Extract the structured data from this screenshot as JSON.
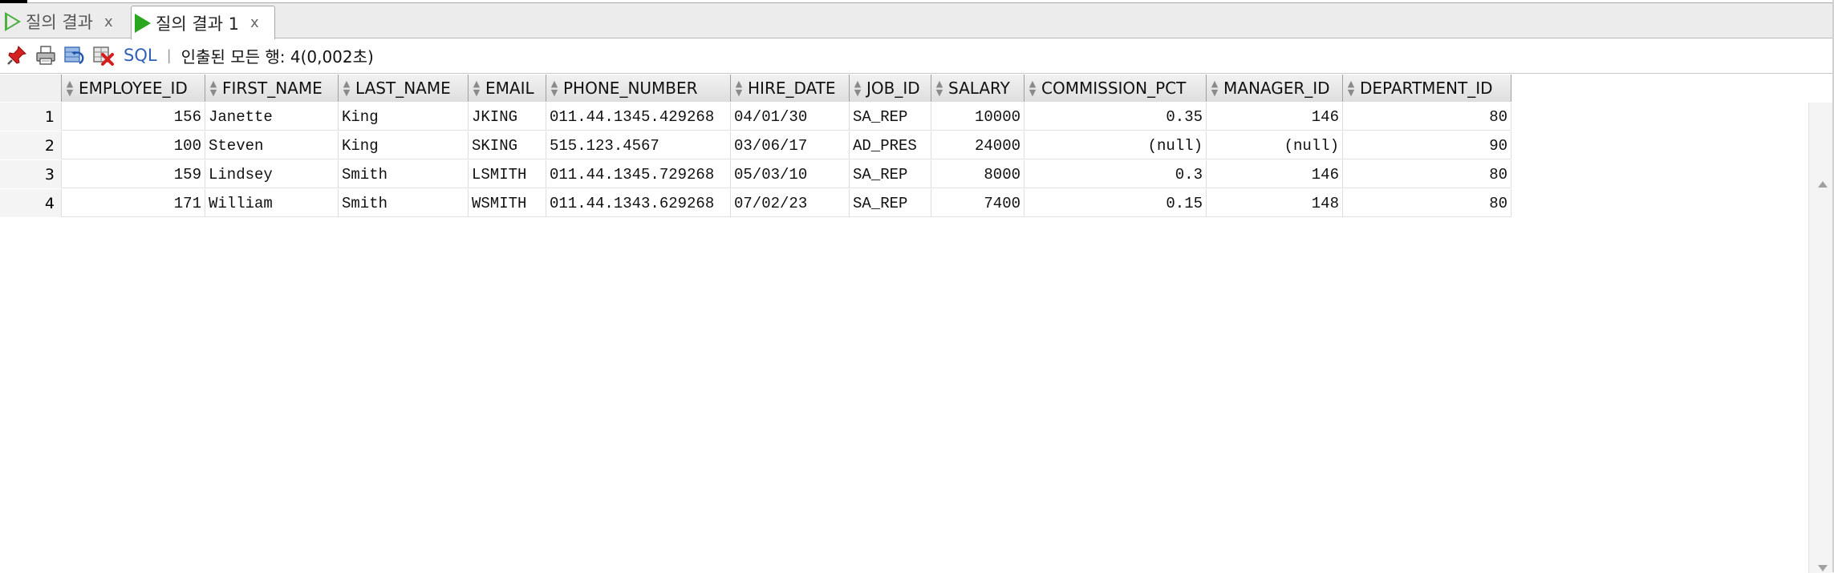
{
  "tabs": [
    {
      "label": "질의 결과",
      "close": "x",
      "active": false
    },
    {
      "label": "질의 결과 1",
      "close": "x",
      "active": true
    }
  ],
  "toolbar": {
    "icons": [
      "pin-icon",
      "print-icon",
      "refresh-icon",
      "cancel-query-icon"
    ],
    "sql_label": "SQL",
    "separator": "|",
    "status": "인출된 모든 행: 4(0,002초)"
  },
  "grid": {
    "columns": [
      "EMPLOYEE_ID",
      "FIRST_NAME",
      "LAST_NAME",
      "EMAIL",
      "PHONE_NUMBER",
      "HIRE_DATE",
      "JOB_ID",
      "SALARY",
      "COMMISSION_PCT",
      "MANAGER_ID",
      "DEPARTMENT_ID"
    ],
    "rows": [
      {
        "n": "1",
        "cells": [
          "156",
          "Janette",
          "King",
          "JKING",
          "011.44.1345.429268",
          "04/01/30",
          "SA_REP",
          "10000",
          "0.35",
          "146",
          "80"
        ]
      },
      {
        "n": "2",
        "cells": [
          "100",
          "Steven",
          "King",
          "SKING",
          "515.123.4567",
          "03/06/17",
          "AD_PRES",
          "24000",
          "(null)",
          "(null)",
          "90"
        ]
      },
      {
        "n": "3",
        "cells": [
          "159",
          "Lindsey",
          "Smith",
          "LSMITH",
          "011.44.1345.729268",
          "05/03/10",
          "SA_REP",
          "8000",
          "0.3",
          "146",
          "80"
        ]
      },
      {
        "n": "4",
        "cells": [
          "171",
          "William",
          "Smith",
          "WSMITH",
          "011.44.1343.629268",
          "07/02/23",
          "SA_REP",
          "7400",
          "0.15",
          "148",
          "80"
        ]
      }
    ]
  },
  "colors": {
    "accent_green": "#2aa61f",
    "sql_link": "#2f5fb8",
    "header_bg": "#e6e6e6"
  }
}
